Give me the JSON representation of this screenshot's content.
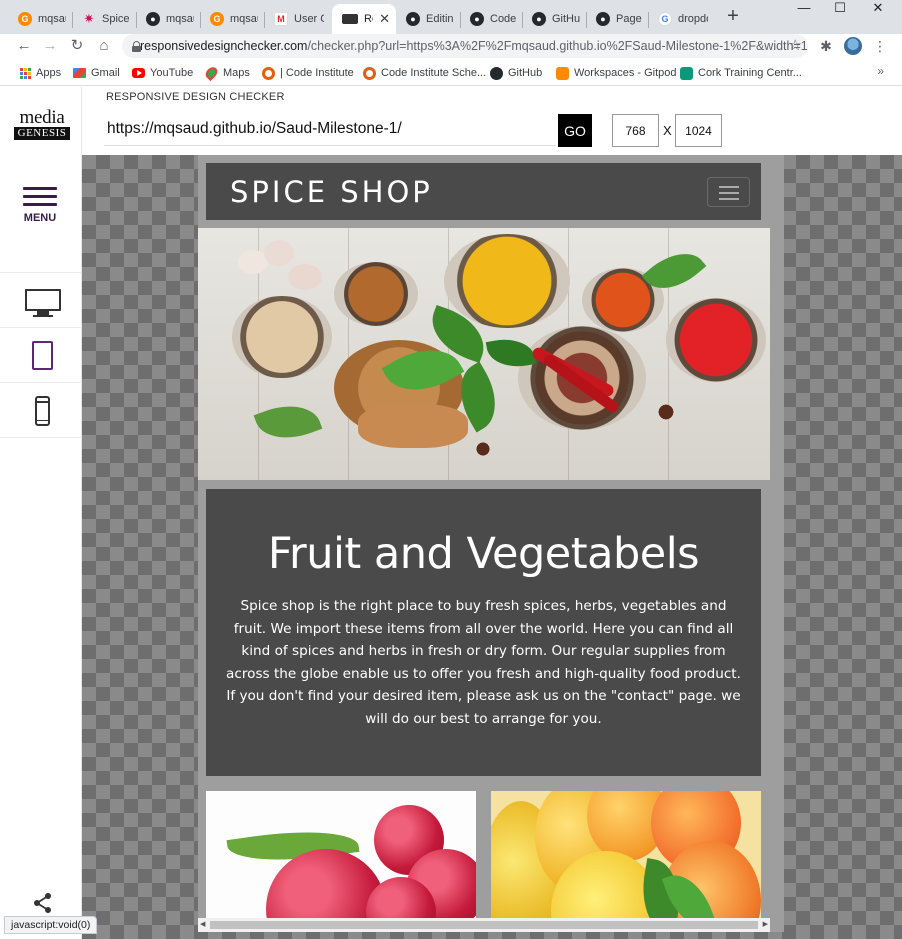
{
  "browser": {
    "tabs": [
      {
        "title": "mqsau",
        "icon": "gitpod-icon",
        "active": false
      },
      {
        "title": "Spice S",
        "icon": "spice-icon",
        "active": false
      },
      {
        "title": "mqsau",
        "icon": "github-icon",
        "active": false
      },
      {
        "title": "mqsau",
        "icon": "gitpod-icon",
        "active": false
      },
      {
        "title": "User C",
        "icon": "gmail-icon",
        "active": false
      },
      {
        "title": "Res",
        "icon": "rdc-icon",
        "active": true
      },
      {
        "title": "Editing",
        "icon": "github-icon",
        "active": false
      },
      {
        "title": "Code-I",
        "icon": "github-icon",
        "active": false
      },
      {
        "title": "GitHub",
        "icon": "github-icon",
        "active": false
      },
      {
        "title": "Pages",
        "icon": "github-icon",
        "active": false
      },
      {
        "title": "dropdo",
        "icon": "google-icon",
        "active": false
      }
    ],
    "new_tab": "+",
    "window_controls": {
      "minimize": "—",
      "maximize": "☐",
      "close": "✕"
    },
    "address": {
      "host": "responsivedesignchecker.com",
      "path": "/checker.php?url=https%3A%2F%2Fmqsaud.github.io%2FSaud-Milestone-1%2F&width=1..."
    },
    "bookmarks": [
      {
        "label": "Apps",
        "icon": "apps-icon"
      },
      {
        "label": "Gmail",
        "icon": "gmail-icon"
      },
      {
        "label": "YouTube",
        "icon": "youtube-icon"
      },
      {
        "label": "Maps",
        "icon": "maps-icon"
      },
      {
        "label": "| Code Institute",
        "icon": "code-institute-icon"
      },
      {
        "label": "Code Institute Sche...",
        "icon": "code-institute-icon"
      },
      {
        "label": "GitHub",
        "icon": "github-icon"
      },
      {
        "label": "Workspaces - Gitpod",
        "icon": "gitpod-icon"
      },
      {
        "label": "Cork Training Centr...",
        "icon": "cork-icon"
      }
    ],
    "bookmarks_more": "»",
    "status_text": "javascript:void(0)"
  },
  "rdc": {
    "logo": {
      "top": "media",
      "bottom": "GENESIS"
    },
    "title": "RESPONSIVE DESIGN CHECKER",
    "menu_label": "MENU",
    "url_value": "https://mqsaud.github.io/Saud-Milestone-1/",
    "go_label": "GO",
    "width_value": "768",
    "height_value": "1024",
    "times": "X",
    "devices": [
      "desktop-icon",
      "tablet-icon",
      "phone-icon"
    ],
    "active_device": "tablet-icon"
  },
  "site": {
    "brand": "SPICE SHOP",
    "section_title": "Fruit and Vegetabels",
    "section_text": "Spice shop is the right place to buy fresh spices, herbs, vegetables and fruit. We import these items from all over the world. Here you can find all kind of spices and herbs in fresh or dry form. Our regular supplies from across the globe enable us to offer you fresh and high-quality food product. If you don't find your desired item, please ask us on the \"contact\" page. we will do our best to arrange for you."
  },
  "colors": {
    "accent_purple": "#5b2a73",
    "site_panel": "#4a4a4a",
    "frame_gray": "#9e9e9e"
  }
}
